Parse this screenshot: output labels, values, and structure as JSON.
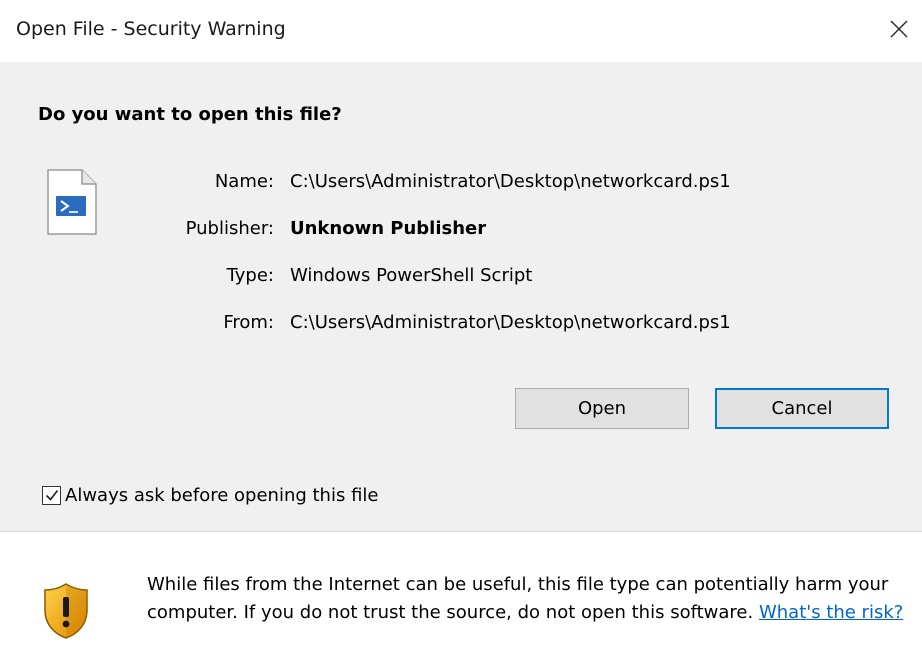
{
  "window": {
    "title": "Open File - Security Warning",
    "close_icon": "close-icon"
  },
  "dialog": {
    "question": "Do you want to open this file?",
    "file_icon": "powershell-script-file-icon",
    "details": {
      "name_label": "Name:",
      "name_value": "C:\\Users\\Administrator\\Desktop\\networkcard.ps1",
      "publisher_label": "Publisher:",
      "publisher_value": "Unknown Publisher",
      "type_label": "Type:",
      "type_value": "Windows PowerShell Script",
      "from_label": "From:",
      "from_value": "C:\\Users\\Administrator\\Desktop\\networkcard.ps1"
    },
    "buttons": {
      "open_label": "Open",
      "cancel_label": "Cancel"
    },
    "checkbox": {
      "label": "Always ask before opening this file",
      "checked": true
    }
  },
  "footer": {
    "shield_icon": "warning-shield-icon",
    "warning_text": "While files from the Internet can be useful, this file type can potentially harm your computer. If you do not trust the source, do not open this software.",
    "risk_link": "What's the risk?"
  },
  "colors": {
    "accent": "#0078d7",
    "link": "#0066cc",
    "panel_bg": "#f0f0f0",
    "button_bg": "#e1e1e1"
  }
}
